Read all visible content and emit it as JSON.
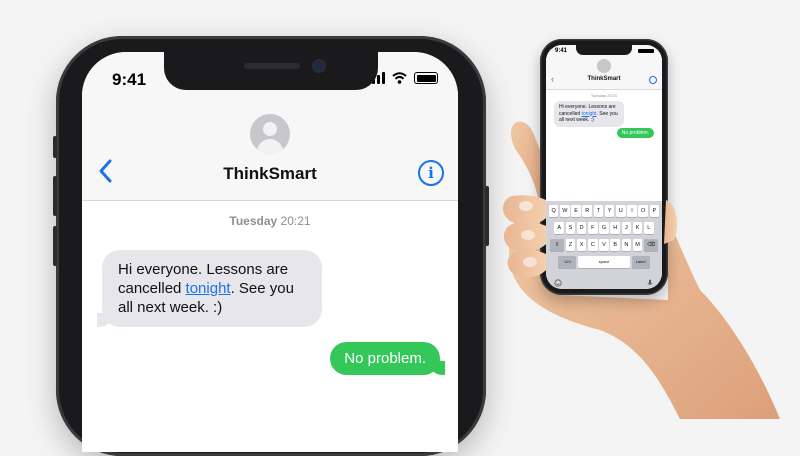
{
  "big_phone": {
    "status": {
      "time": "9:41"
    },
    "contact": {
      "name": "ThinkSmart"
    },
    "conversation": {
      "day": "Tuesday",
      "time": "20:21",
      "incoming": {
        "text_before": "Hi everyone. Lessons are cancelled ",
        "link": "tonight",
        "text_after": ". See you all next week. :)"
      },
      "outgoing": {
        "text": "No problem."
      }
    }
  },
  "small_phone": {
    "status": {
      "time": "9:41"
    },
    "contact": {
      "name": "ThinkSmart"
    },
    "timestamp": "Tuesday 20:21",
    "incoming": {
      "text_before": "Hi everyone. Lessons are cancelled ",
      "link": "tonight",
      "text_after": ". See you all next week. :)"
    },
    "outgoing": {
      "text": "No problem."
    },
    "keyboard": {
      "row1": [
        "Q",
        "W",
        "E",
        "R",
        "T",
        "Y",
        "U",
        "I",
        "O",
        "P"
      ],
      "row2": [
        "A",
        "S",
        "D",
        "F",
        "G",
        "H",
        "J",
        "K",
        "L"
      ],
      "row3": [
        "Z",
        "X",
        "C",
        "V",
        "B",
        "N",
        "M"
      ],
      "numbers_key": "123",
      "space_key": "space",
      "return_key": "Label"
    }
  },
  "colors": {
    "link_blue": "#1a73e8",
    "outgoing_bubble": "#34c759",
    "incoming_bubble": "#e6e6eb"
  }
}
